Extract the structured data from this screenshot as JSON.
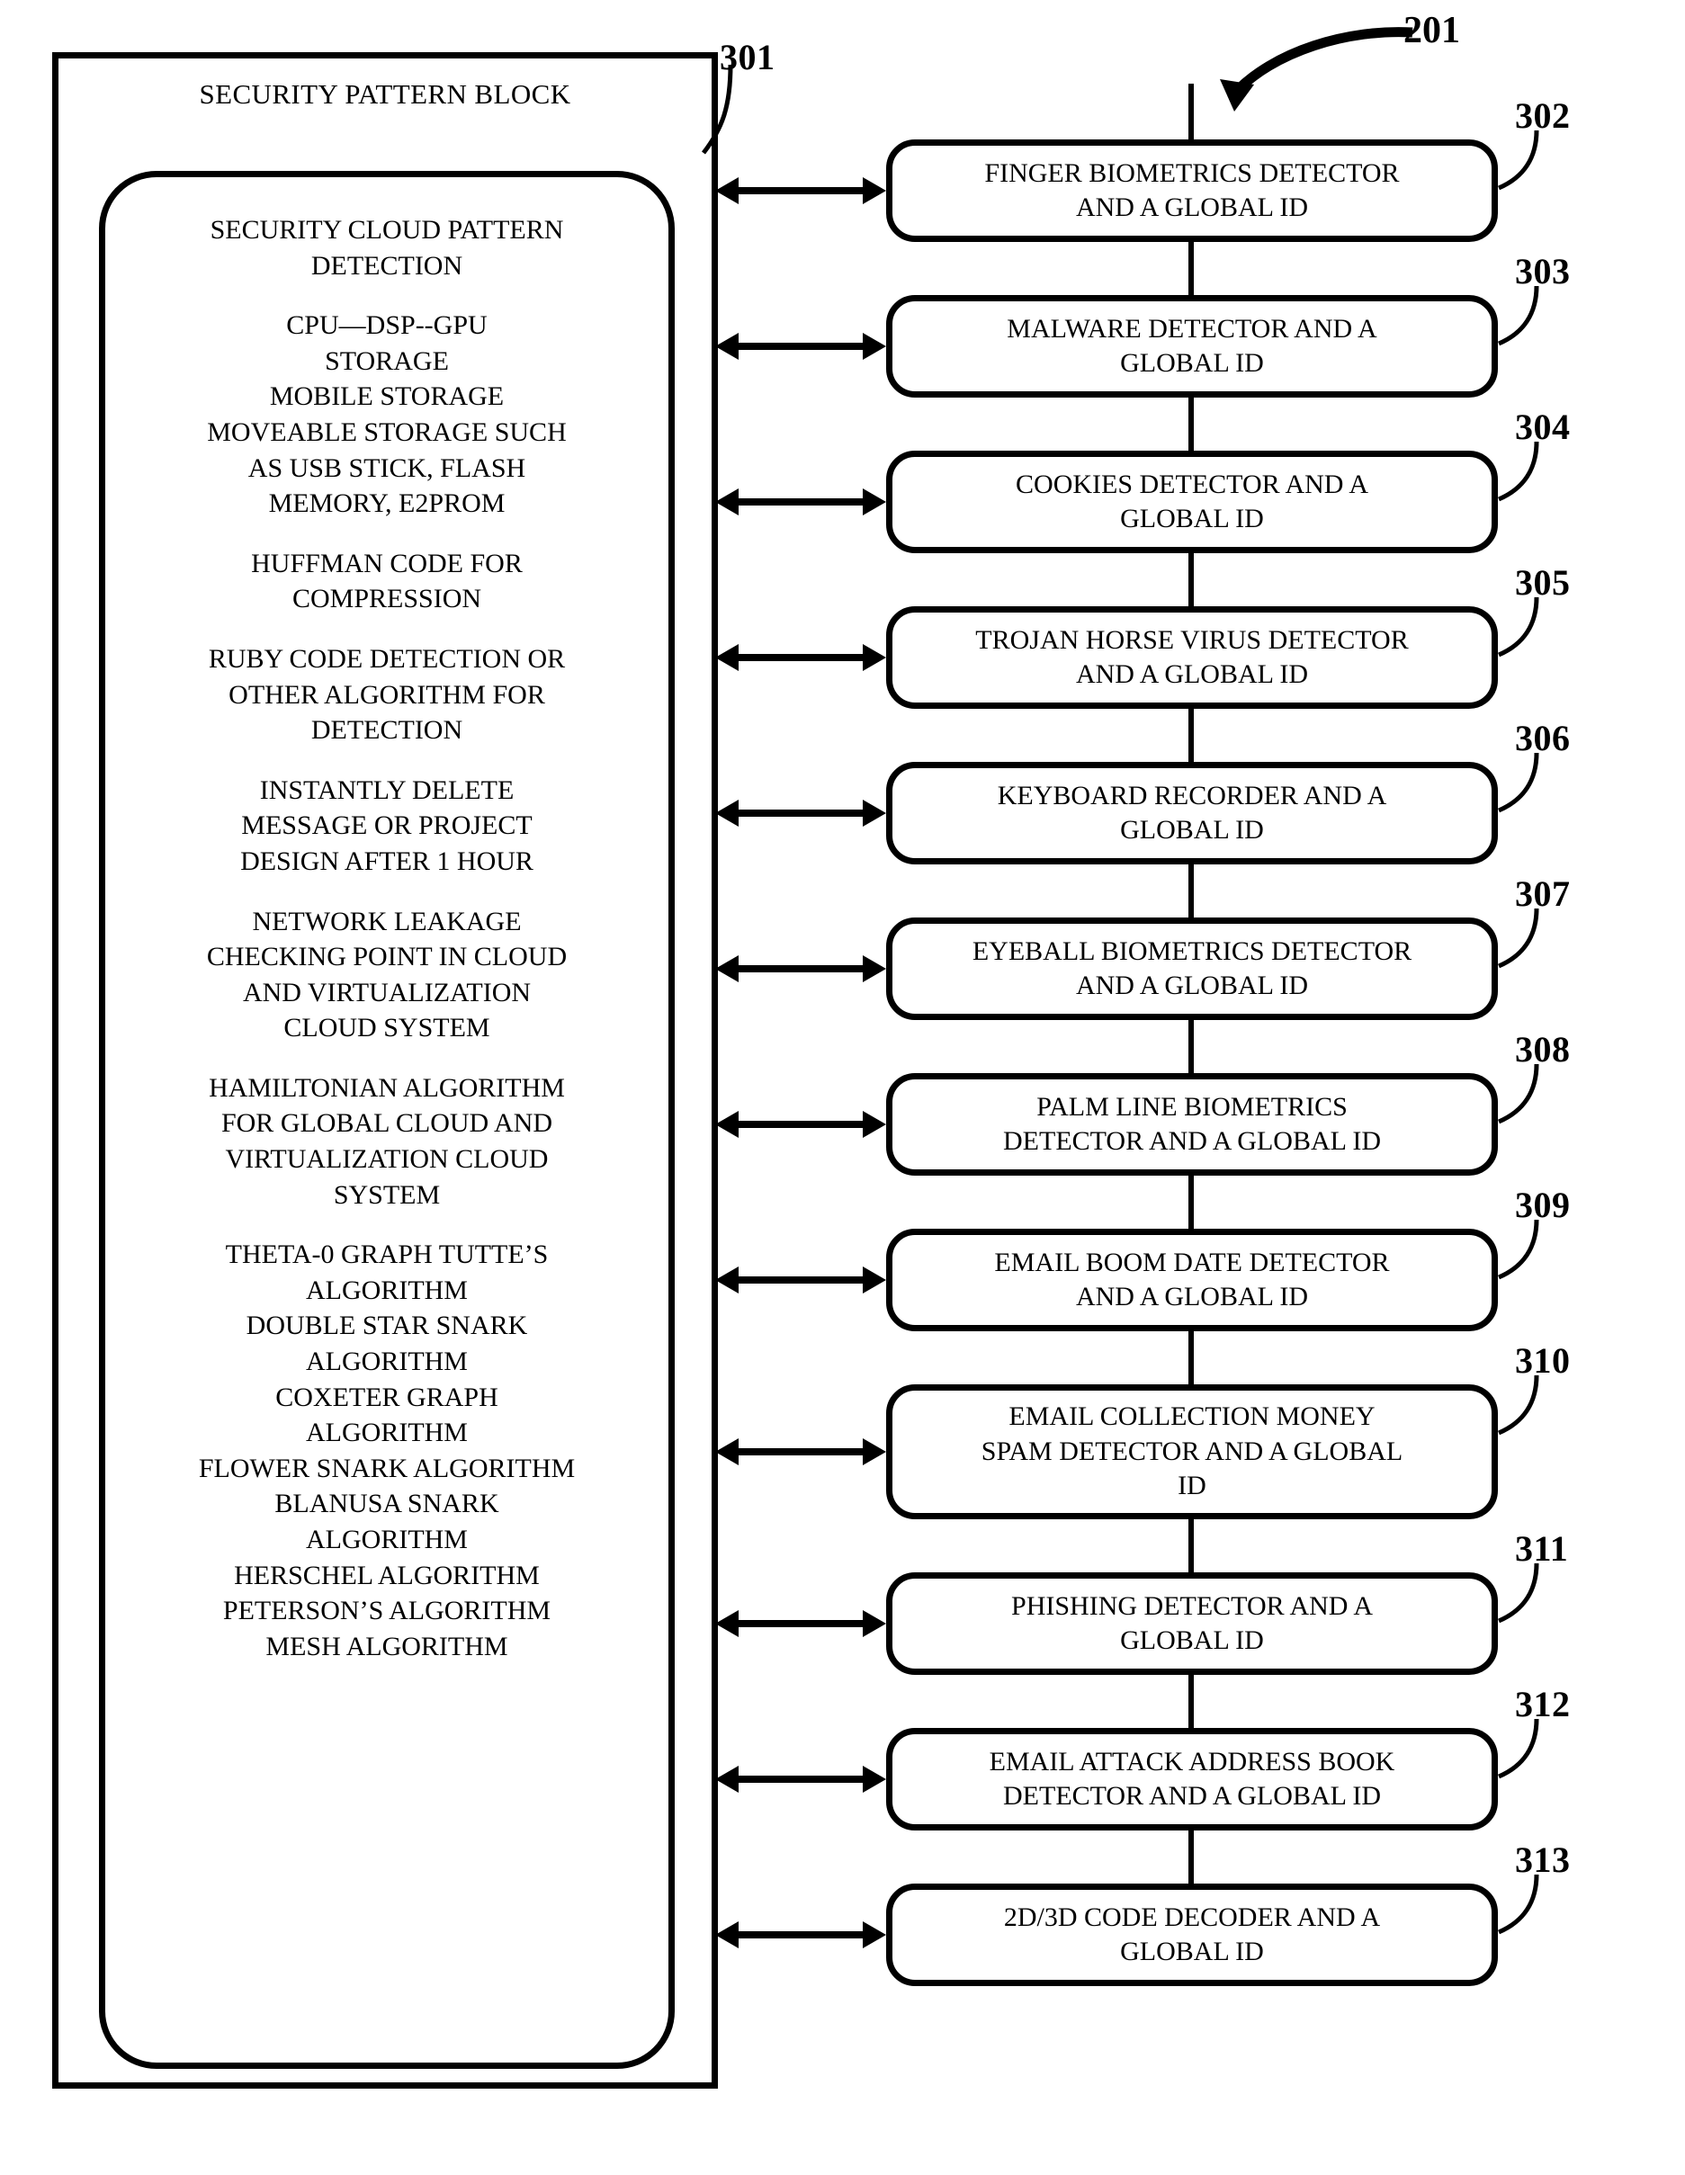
{
  "figure": {
    "system_ref": "201",
    "block_ref": "301"
  },
  "security_block": {
    "title": "SECURITY PATTERN BLOCK",
    "inner_paragraphs": [
      [
        "SECURITY CLOUD PATTERN",
        "DETECTION"
      ],
      [
        "CPU—DSP--GPU",
        "STORAGE",
        "MOBILE STORAGE",
        "MOVEABLE STORAGE SUCH",
        "AS USB STICK, FLASH",
        "MEMORY, E2PROM"
      ],
      [
        "HUFFMAN CODE FOR",
        "COMPRESSION"
      ],
      [
        "RUBY CODE DETECTION OR",
        "OTHER ALGORITHM FOR",
        "DETECTION"
      ],
      [
        "INSTANTLY DELETE",
        "MESSAGE OR PROJECT",
        "DESIGN AFTER 1 HOUR"
      ],
      [
        "NETWORK LEAKAGE",
        "CHECKING POINT IN CLOUD",
        "AND VIRTUALIZATION",
        "CLOUD SYSTEM"
      ],
      [
        "HAMILTONIAN ALGORITHM",
        "FOR GLOBAL CLOUD AND",
        "VIRTUALIZATION CLOUD",
        "SYSTEM"
      ],
      [
        "THETA-0 GRAPH TUTTE’S",
        "ALGORITHM",
        "DOUBLE STAR SNARK",
        "ALGORITHM",
        "COXETER GRAPH",
        "ALGORITHM",
        "FLOWER SNARK ALGORITHM",
        "BLANUSA SNARK",
        "ALGORITHM",
        "HERSCHEL ALGORITHM",
        "PETERSON’S ALGORITHM",
        "MESH ALGORITHM"
      ]
    ]
  },
  "detectors": [
    {
      "ref": "302",
      "lines": [
        "FINGER BIOMETRICS DETECTOR",
        "AND A GLOBAL ID"
      ]
    },
    {
      "ref": "303",
      "lines": [
        "MALWARE DETECTOR AND A",
        "GLOBAL ID"
      ]
    },
    {
      "ref": "304",
      "lines": [
        "COOKIES DETECTOR AND A",
        "GLOBAL ID"
      ]
    },
    {
      "ref": "305",
      "lines": [
        "TROJAN HORSE VIRUS DETECTOR",
        "AND A GLOBAL ID"
      ]
    },
    {
      "ref": "306",
      "lines": [
        "KEYBOARD RECORDER AND A",
        "GLOBAL ID"
      ]
    },
    {
      "ref": "307",
      "lines": [
        "EYEBALL BIOMETRICS DETECTOR",
        "AND A GLOBAL ID"
      ]
    },
    {
      "ref": "308",
      "lines": [
        "PALM LINE BIOMETRICS",
        "DETECTOR AND A GLOBAL ID"
      ]
    },
    {
      "ref": "309",
      "lines": [
        "EMAIL BOOM DATE DETECTOR",
        "AND A GLOBAL ID"
      ]
    },
    {
      "ref": "310",
      "lines": [
        "EMAIL COLLECTION MONEY",
        "SPAM DETECTOR AND A GLOBAL",
        "ID"
      ]
    },
    {
      "ref": "311",
      "lines": [
        "PHISHING DETECTOR AND A",
        "GLOBAL ID"
      ]
    },
    {
      "ref": "312",
      "lines": [
        "EMAIL ATTACK ADDRESS BOOK",
        "DETECTOR AND A GLOBAL ID"
      ]
    },
    {
      "ref": "313",
      "lines": [
        "2D/3D CODE DECODER AND A",
        "GLOBAL ID"
      ]
    }
  ],
  "colors": {
    "ink": "#000000",
    "paper": "#ffffff"
  }
}
